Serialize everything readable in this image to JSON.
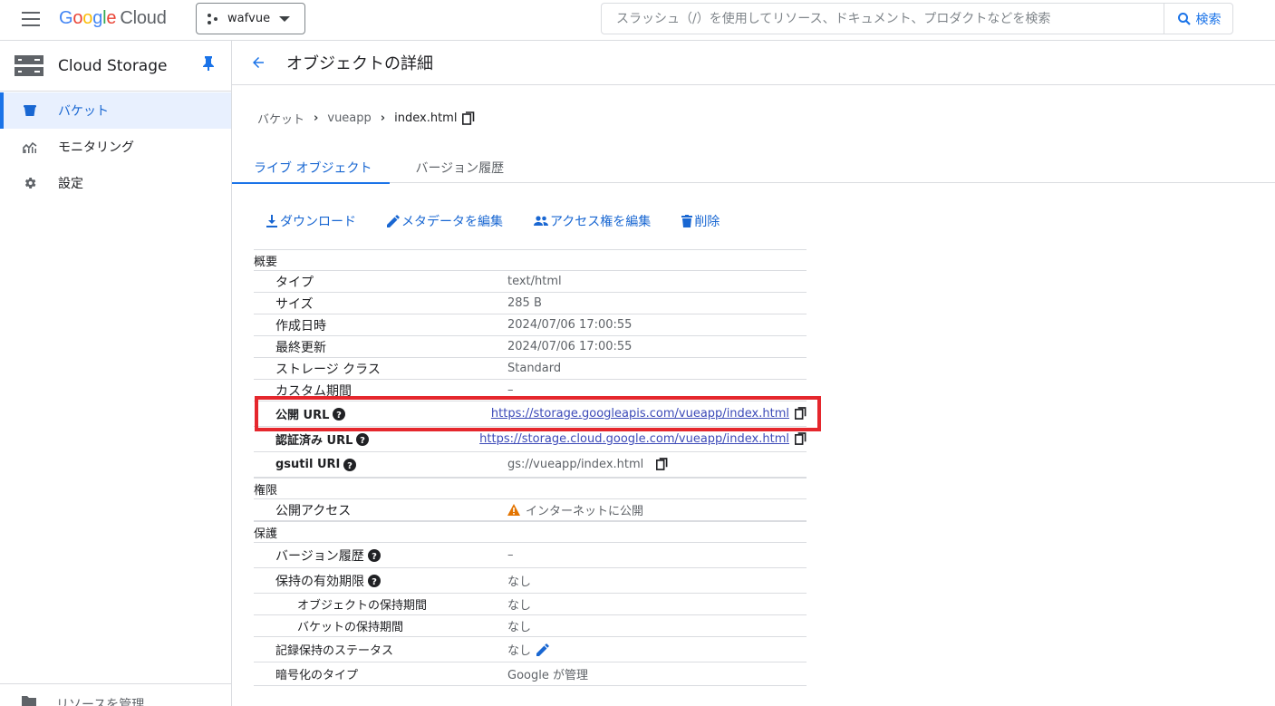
{
  "header": {
    "logo": {
      "g1": "G",
      "g2": "o",
      "g3": "o",
      "g4": "g",
      "g5": "l",
      "g6": "e",
      "cloud": "Cloud"
    },
    "project_name": "wafvue",
    "search_placeholder": "スラッシュ（/）を使用してリソース、ドキュメント、プロダクトなどを検索",
    "search_button": "検索"
  },
  "sidebar": {
    "title": "Cloud Storage",
    "items": [
      {
        "label": "バケット",
        "icon": "bucket-icon",
        "active": true
      },
      {
        "label": "モニタリング",
        "icon": "monitoring-icon",
        "active": false
      },
      {
        "label": "設定",
        "icon": "gear-icon",
        "active": false
      }
    ],
    "footer": "リソースを管理"
  },
  "page": {
    "title": "オブジェクトの詳細",
    "breadcrumb": [
      "バケット",
      "vueapp",
      "index.html"
    ],
    "tabs": [
      "ライブ オブジェクト",
      "バージョン履歴"
    ],
    "actions": [
      "ダウンロード",
      "メタデータを編集",
      "アクセス権を編集",
      "削除"
    ]
  },
  "details": {
    "overview": "概要",
    "type_label": "タイプ",
    "type_value": "text/html",
    "size_label": "サイズ",
    "size_value": "285 B",
    "created_label": "作成日時",
    "created_value": "2024/07/06 17:00:55",
    "updated_label": "最終更新",
    "updated_value": "2024/07/06 17:00:55",
    "storage_class_label": "ストレージ クラス",
    "storage_class_value": "Standard",
    "custom_time_label": "カスタム期間",
    "custom_time_value": "–",
    "public_url_label": "公開 URL",
    "public_url_value": "https://storage.googleapis.com/vueapp/index.html",
    "auth_url_label": "認証済み URL",
    "auth_url_value": "https://storage.cloud.google.com/vueapp/index.html",
    "gsutil_label": "gsutil URI",
    "gsutil_value": "gs://vueapp/index.html",
    "permissions": "権限",
    "public_access_label": "公開アクセス",
    "public_access_value": "インターネットに公開",
    "protection": "保護",
    "versioning_label": "バージョン履歴",
    "versioning_value": "–",
    "retention_label": "保持の有効期限",
    "retention_value": "なし",
    "object_retention_label": "オブジェクトの保持期間",
    "object_retention_value": "なし",
    "bucket_retention_label": "バケットの保持期間",
    "bucket_retention_value": "なし",
    "hold_label": "記録保持のステータス",
    "hold_value": "なし",
    "encryption_label": "暗号化のタイプ",
    "encryption_value": "Google が管理"
  },
  "colors": {
    "accent": "#1a73e8",
    "highlight": "#e5272d",
    "warning": "#e37400"
  }
}
